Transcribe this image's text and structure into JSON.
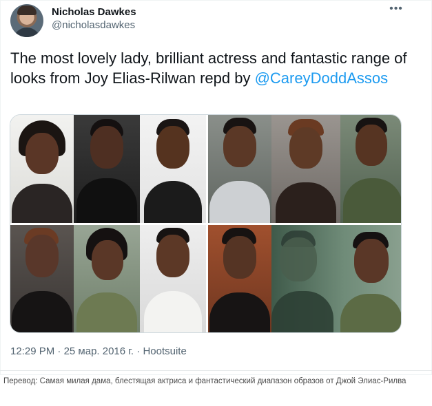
{
  "author": {
    "name": "Nicholas Dawkes",
    "handle": "@nicholasdawkes"
  },
  "menu_icon": "more-horizontal-icon",
  "tweet": {
    "text_before": "The most lovely lady, brilliant actress and fantastic range of looks from Joy  Elias-Rilwan repd by ",
    "mention": "@CareyDoddAssos"
  },
  "meta": {
    "time": "12:29 PM",
    "separator1": " · ",
    "date": "25 мар. 2016 г.",
    "separator2": " · ",
    "source": "Hootsuite"
  },
  "translation": "Перевод: Самая милая дама, блестящая актриса и фантастический диапазон образов от Джой Элиас-Рилва"
}
